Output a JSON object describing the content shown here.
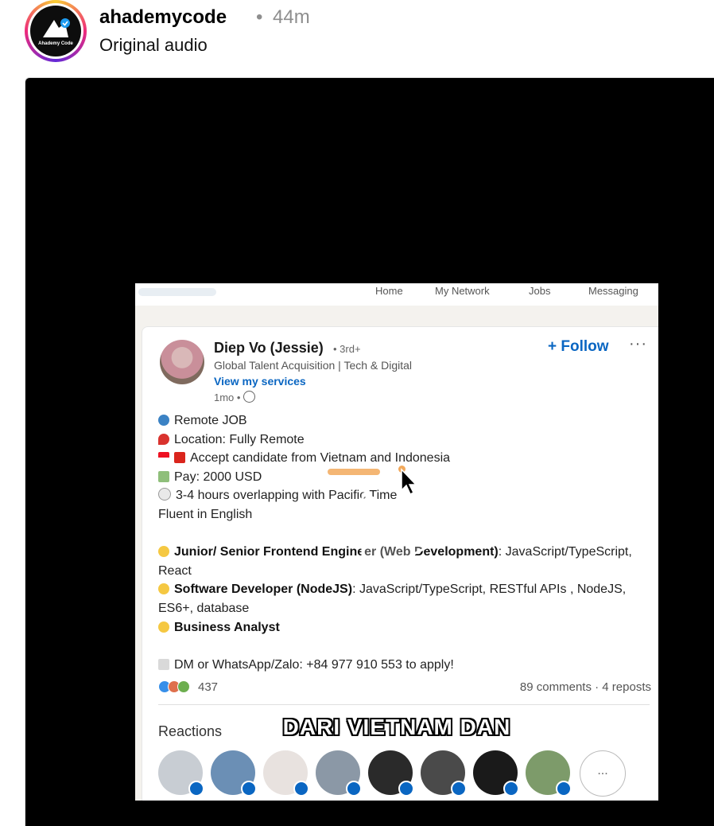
{
  "header": {
    "username": "ahademycode",
    "separator": "•",
    "time_ago": "44m",
    "audio": "Original audio",
    "avatar_text": "Ahademy Code"
  },
  "video": {
    "nav": [
      "Home",
      "My Network",
      "Jobs",
      "Messaging"
    ],
    "post": {
      "author_name": "Diep Vo (Jessie)",
      "degree": "• 3rd+",
      "headline": "Global Talent Acquisition | Tech & Digital",
      "services_link": "View my services",
      "posted": "1mo •",
      "follow_label": "+ Follow",
      "more_label": "···",
      "lines": {
        "l1": "Remote JOB",
        "l2": "Location: Fully Remote",
        "l3": "Accept candidate from Vietnam and Indonesia",
        "l4": "Pay: 2000 USD",
        "l5": "3-4 hours overlapping with Pacific Time",
        "l6": "Fluent in English",
        "l7_bold": "Junior/ Senior Frontend Engineer (Web Development)",
        "l7_rest": ": JavaScript/TypeScript,",
        "l8": "React",
        "l9_bold": "Software Developer (NodeJS)",
        "l9_rest": ": JavaScript/TypeScript, RESTful APIs , NodeJS,",
        "l10": "ES6+, database",
        "l11_bold": "Business Analyst",
        "l12": "DM or WhatsApp/Zalo: +84 977 910 553 to apply!"
      },
      "reaction_count": "437",
      "comments_reposts": "89 comments · 4 reposts",
      "reactions_label": "Reactions",
      "more_faces": "..."
    },
    "caption": "DARI VIETNAM DAN"
  }
}
